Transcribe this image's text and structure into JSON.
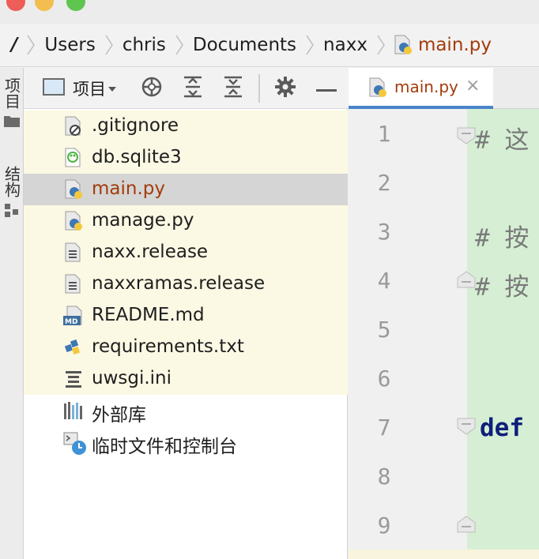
{
  "breadcrumb": {
    "root": "/",
    "items": [
      "Users",
      "chris",
      "Documents",
      "naxx"
    ],
    "active_file": "main.py"
  },
  "toolstrip": {
    "project_tab": "项目",
    "structure_tab": "结构"
  },
  "panel": {
    "view_selector": "项目",
    "icons": [
      "locate-icon",
      "expand-all-icon",
      "collapse-all-icon",
      "gear-icon",
      "minimize-icon"
    ]
  },
  "tree": {
    "items": [
      {
        "name": ".gitignore",
        "icon": "gitignore-file-icon"
      },
      {
        "name": "db.sqlite3",
        "icon": "sqlite-file-icon"
      },
      {
        "name": "main.py",
        "icon": "python-file-icon",
        "selected": true
      },
      {
        "name": "manage.py",
        "icon": "python-file-icon"
      },
      {
        "name": "naxx.release",
        "icon": "text-file-icon"
      },
      {
        "name": "naxxramas.release",
        "icon": "text-file-icon"
      },
      {
        "name": "README.md",
        "icon": "markdown-file-icon"
      },
      {
        "name": "requirements.txt",
        "icon": "requirements-file-icon"
      },
      {
        "name": "uwsgi.ini",
        "icon": "ini-file-icon"
      },
      {
        "name": "外部库",
        "icon": "external-libraries-icon"
      },
      {
        "name": "临时文件和控制台",
        "icon": "scratches-icon"
      }
    ]
  },
  "editor": {
    "tab": {
      "name": "main.py",
      "close": "×"
    },
    "line_numbers": [
      "1",
      "2",
      "3",
      "4",
      "5",
      "6",
      "7",
      "8",
      "9"
    ],
    "code": [
      {
        "line": "1",
        "text": "# 这",
        "kind": "comment"
      },
      {
        "line": "3",
        "text": "# 按",
        "kind": "comment"
      },
      {
        "line": "4",
        "text": "# 按",
        "kind": "comment"
      },
      {
        "line": "7",
        "text": "def",
        "kind": "keyword"
      }
    ]
  },
  "colors": {
    "active_file": "#a33c0b",
    "tab_underline": "#4a83c9",
    "tinted_row": "#fbf8e4",
    "selected_row": "#d5d5d5",
    "code_bg": "#d6efd4",
    "keyword": "#0f1f7a",
    "comment": "#7a7a7a"
  }
}
